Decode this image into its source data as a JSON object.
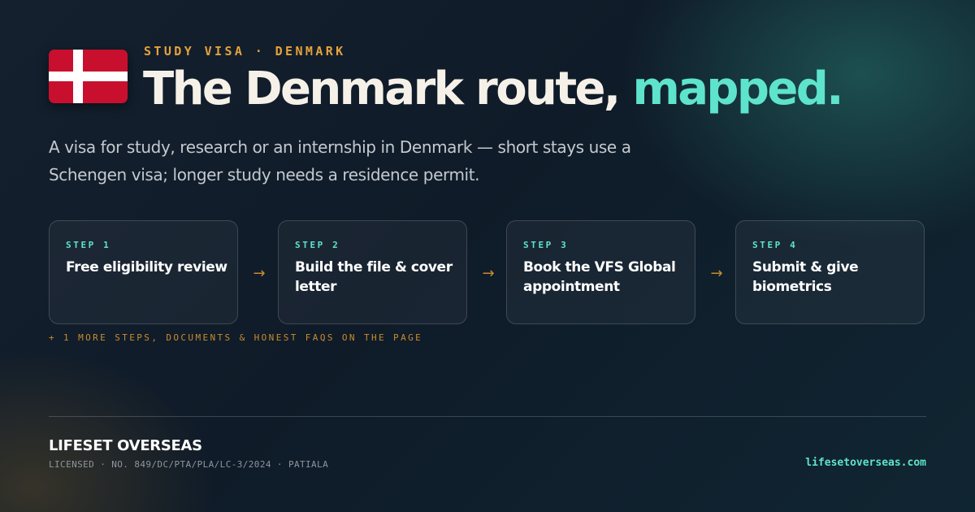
{
  "colors": {
    "accent": "#5ee4cc",
    "highlight": "#e6a23a",
    "flag_red": "#c8102e",
    "flag_white": "#ffffff",
    "background": "#121f2c"
  },
  "header": {
    "flag_icon": "denmark-flag-icon",
    "eyebrow": "STUDY VISA · DENMARK",
    "headline_main": "The Denmark route,",
    "headline_accent": "mapped."
  },
  "subtitle": "A visa for study, research or an internship in Denmark — short stays use a Schengen visa; longer study needs a residence permit.",
  "steps": [
    {
      "label": "STEP 1",
      "title": "Free eligibility review"
    },
    {
      "label": "STEP 2",
      "title": "Build the file & cover letter"
    },
    {
      "label": "STEP 3",
      "title": "Book the VFS Global appointment"
    },
    {
      "label": "STEP 4",
      "title": "Submit & give biometrics"
    }
  ],
  "arrow_glyph": "→",
  "more_note": "+ 1 MORE STEPS, DOCUMENTS & HONEST FAQS ON THE PAGE",
  "footer": {
    "brand": "LIFESET OVERSEAS",
    "license": "LICENSED · NO. 849/DC/PTA/PLA/LC-3/2024 · PATIALA",
    "website": "lifesetoverseas.com"
  }
}
